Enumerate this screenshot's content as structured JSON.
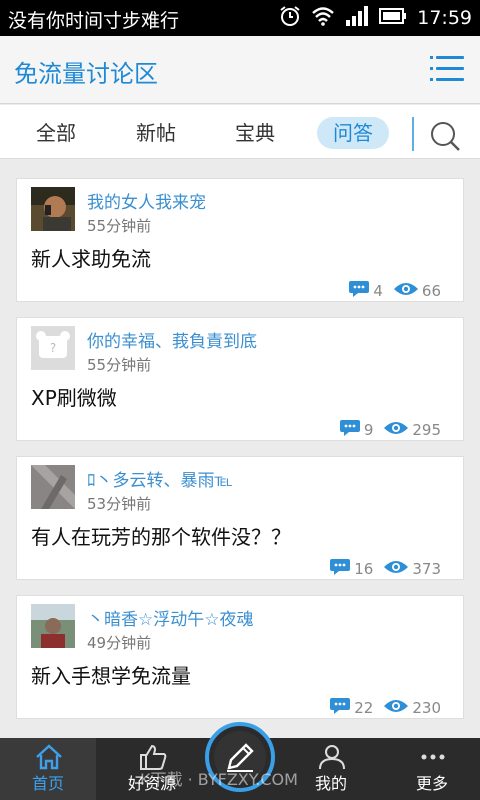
{
  "status_bar": {
    "notification_text": "没有你时间寸步难行",
    "time": "17:59",
    "icons": [
      "alarm-icon",
      "wifi-icon",
      "signal-icon",
      "battery-icon"
    ]
  },
  "app_bar": {
    "title": "免流量讨论区",
    "menu_icon": "menu-icon"
  },
  "tabs": [
    {
      "label": "全部"
    },
    {
      "label": "新帖"
    },
    {
      "label": "宝典"
    },
    {
      "label": "问答",
      "active": true
    }
  ],
  "search_icon": "search-icon",
  "posts": [
    {
      "username": "我的女人我来宠",
      "time": "55分钟前",
      "title": "新人求助免流",
      "comments": "4",
      "views": "66"
    },
    {
      "username": "你的幸福、莪負責到底",
      "time": "55分钟前",
      "title": "XP刷微微",
      "comments": "9",
      "views": "295"
    },
    {
      "username": "ﾛ丶多云转、暴雨℡",
      "time": "53分钟前",
      "title": "有人在玩芳的那个软件没？？",
      "comments": "16",
      "views": "373"
    },
    {
      "username": "丶暗香☆浮动午☆夜魂",
      "time": "49分钟前",
      "title": "新入手想学免流量",
      "comments": "22",
      "views": "230"
    }
  ],
  "bottom_nav": [
    {
      "label": "首页",
      "icon": "home-icon",
      "active": true
    },
    {
      "label": "好资源",
      "icon": "thumbs-up-icon"
    },
    {
      "label": "",
      "icon": "pencil-icon"
    },
    {
      "label": "我的",
      "icon": "user-icon"
    },
    {
      "label": "更多",
      "icon": "more-icon"
    }
  ],
  "watermark": "K下载 · BYFZXY.COM",
  "colors": {
    "accent": "#1e8ad6",
    "tab_active_bg": "#cfe8f8",
    "bottom_bar": "#2b2b2b",
    "nav_active": "#3ea0ea"
  }
}
